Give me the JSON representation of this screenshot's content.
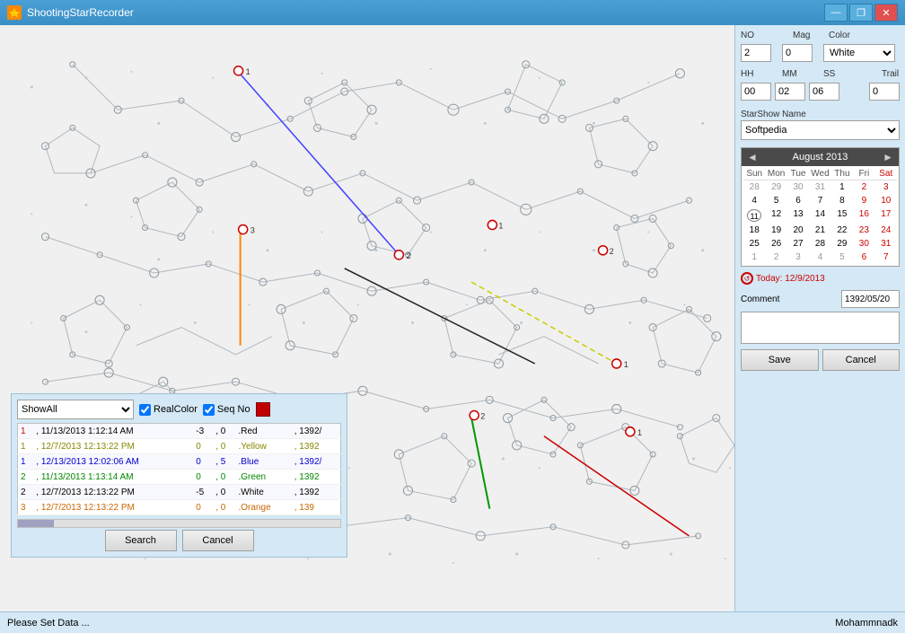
{
  "window": {
    "title": "ShootingStarRecorder",
    "min_label": "—",
    "restore_label": "❐",
    "close_label": "✕"
  },
  "right_panel": {
    "no_label": "NO",
    "mag_label": "Mag",
    "color_label": "Color",
    "no_value": "2",
    "mag_value": "0",
    "color_value": "White",
    "hh_label": "HH",
    "mm_label": "MM",
    "ss_label": "SS",
    "trail_label": "Trail",
    "hh_value": "00",
    "mm_value": "02",
    "ss_value": "06",
    "trail_value": "0",
    "starshow_label": "StarShow Name",
    "starshow_value": "Softpedia",
    "comment_label": "Comment",
    "comment_date": "1392/05/20",
    "today_label": "Today: 12/9/2013",
    "save_label": "Save",
    "cancel_label": "Cancel"
  },
  "calendar": {
    "month_year": "August 2013",
    "prev_label": "◄",
    "next_label": "►",
    "day_headers": [
      "Sun",
      "Mon",
      "Tue",
      "Wed",
      "Thu",
      "Fri",
      "Sat"
    ],
    "weeks": [
      [
        "28",
        "29",
        "30",
        "31",
        "1",
        "2",
        "3"
      ],
      [
        "4",
        "5",
        "6",
        "7",
        "8",
        "9",
        "10"
      ],
      [
        "11",
        "12",
        "13",
        "14",
        "15",
        "16",
        "17"
      ],
      [
        "18",
        "19",
        "20",
        "21",
        "22",
        "23",
        "24"
      ],
      [
        "25",
        "26",
        "27",
        "28",
        "29",
        "30",
        "31"
      ],
      [
        "1",
        "2",
        "3",
        "4",
        "5",
        "6",
        "7"
      ]
    ],
    "week_types": [
      [
        "prev",
        "",
        "",
        "prev",
        "",
        "weekend",
        "weekend"
      ],
      [
        "",
        "",
        "",
        "",
        "",
        "weekend",
        "weekend"
      ],
      [
        "today",
        "",
        "",
        "",
        "",
        "weekend",
        "weekend"
      ],
      [
        "",
        "",
        "",
        "",
        "",
        "weekend",
        "weekend"
      ],
      [
        "",
        "",
        "",
        "",
        "",
        "weekend",
        "weekend"
      ],
      [
        "next",
        "next",
        "next",
        "next",
        "next",
        "next-weekend",
        "next-weekend"
      ]
    ]
  },
  "search_panel": {
    "show_filter": "ShowAll",
    "realcolor_label": "RealColor",
    "seqno_label": "Seq No",
    "rows": [
      {
        "no": "1",
        "date": ", 11/13/2013 1:12:14 AM",
        "mag": "-3",
        "v": ",  0",
        "color": ".Red",
        "year": ", 1392/"
      },
      {
        "no": "1",
        "date": ", 12/7/2013 12:13:22 PM",
        "mag": "0",
        "v": ",  0",
        "color": ".Yellow",
        "year": ", 1392"
      },
      {
        "no": "1",
        "date": ", 12/13/2013 12:02:06 AM",
        "mag": "0",
        "v": ",  5",
        "color": ".Blue",
        "year": ", 1392/"
      },
      {
        "no": "2",
        "date": ", 11/13/2013 1:13:14 AM",
        "mag": "0",
        "v": ",  0",
        "color": ".Green",
        "year": ", 1392"
      },
      {
        "no": "2",
        "date": ", 12/7/2013 12:13:22 PM",
        "mag": "-5",
        "v": ",  0",
        "color": ".White",
        "year": ", 1392"
      },
      {
        "no": "3",
        "date": ", 12/7/2013 12:13:22 PM",
        "mag": "0",
        "v": ",  0",
        "color": ".Orange",
        "year": ", 139"
      }
    ],
    "search_label": "Search",
    "cancel_label": "Cancel"
  },
  "status_bar": {
    "left": "Please Set Data ...",
    "right": "Mohammnadk"
  },
  "colors": {
    "accent": "#4a9fd5",
    "bg": "#d4e8f5",
    "map_bg": "#f0f0f0"
  }
}
